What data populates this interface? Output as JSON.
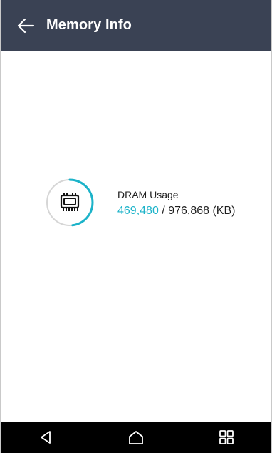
{
  "header": {
    "title": "Memory Info",
    "back_icon": "arrow-left-icon"
  },
  "dram": {
    "label": "DRAM Usage",
    "used": "469,480",
    "separator": " / ",
    "total": "976,868",
    "unit": " (KB)",
    "used_fraction": 0.48,
    "icon": "memory-chip-icon"
  },
  "navbar": {
    "back_icon": "nav-back-icon",
    "home_icon": "nav-home-icon",
    "recents_icon": "nav-recents-icon"
  },
  "colors": {
    "header_bg": "#3a4254",
    "accent": "#1cb3c9",
    "ring_track": "#d6d6d6",
    "navbar_bg": "#000000"
  }
}
